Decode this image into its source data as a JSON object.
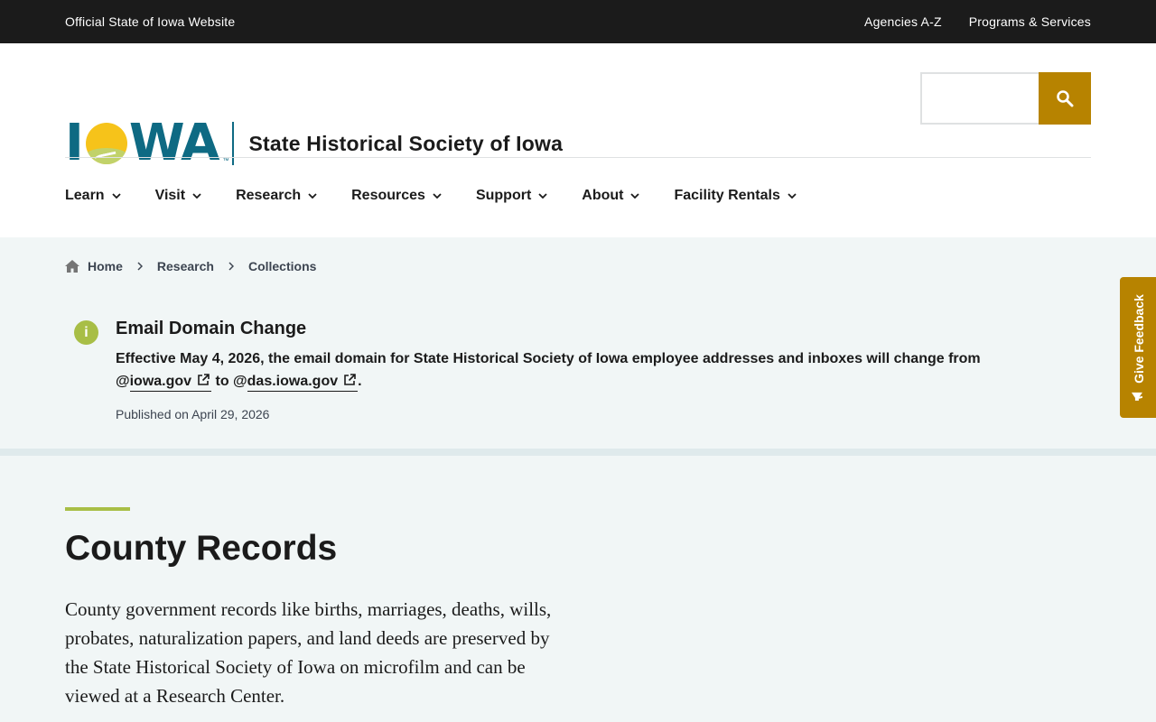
{
  "topbar": {
    "official": "Official State of Iowa Website",
    "links": [
      "Agencies A-Z",
      "Programs & Services"
    ]
  },
  "header": {
    "logo_text": "IOWA",
    "logo_tm": "™",
    "site_name": "State Historical Society of Iowa",
    "search_placeholder": ""
  },
  "nav": {
    "items": [
      "Learn",
      "Visit",
      "Research",
      "Resources",
      "Support",
      "About",
      "Facility Rentals"
    ]
  },
  "breadcrumb": [
    "Home",
    "Research",
    "Collections"
  ],
  "alert": {
    "title": "Email Domain Change",
    "body_prefix": "Effective May 4, 2026, the email domain for State Historical Society of Iowa employee addresses and inboxes will change from @",
    "link1": "iowa.gov",
    "middle": " to @",
    "link2": "das.iowa.gov",
    "suffix": ".",
    "date": "Published on April 29, 2026"
  },
  "main": {
    "title": "County Records",
    "intro": "County government records like births, marriages, deaths, wills, probates, naturalization papers, and land deeds are preserved by the State Historical Society of Iowa on microfilm and can be viewed at a Research Center."
  },
  "feedback": {
    "label": "Give Feedback"
  },
  "colors": {
    "brand_teal": "#0e6a83",
    "accent_gold": "#b78300",
    "accent_green": "#a8be46",
    "topbar_bg": "#1b1b1b"
  }
}
